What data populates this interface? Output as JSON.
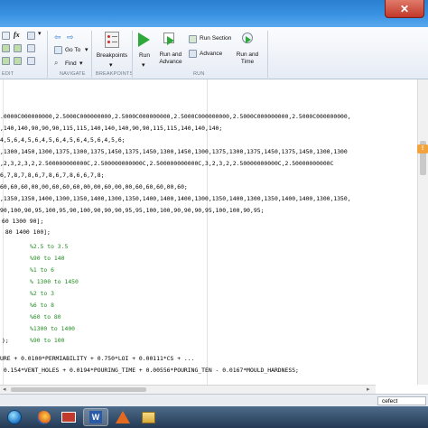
{
  "ribbon": {
    "sections": [
      "EDIT",
      "NAVIGATE",
      "BREAKPOINTS",
      "RUN"
    ],
    "fx_label": "fx",
    "go_to": "Go To",
    "find": "Find",
    "breakpoints": "Breakpoints",
    "run": "Run",
    "run_and_advance": [
      "Run and",
      "Advance"
    ],
    "run_section": "Run Section",
    "advance": "Advance",
    "run_and_time": [
      "Run and",
      "Time"
    ]
  },
  "editor": {
    "lines": [
      ".0000C000000000,2.5000C000000000,2.5000C000000000,2.5000C000000000,2.5000C000000000,2.5000C000000000,",
      ",140,140,90,90,90,115,115,140,140,140,90,90,115,115,140,140,140;",
      "4,5,6,4,5,6,4,5,6,4,5,6,4,5,6,4,5,6;",
      ",1300,1450,1300,1375,1300,1375,1450,1375,1450,1300,1450,1300,1375,1300,1375,1450,1375,1450,1300,1300",
      ",2,3,2,3,2,2.500000000000C,2.500000000000C,2.500000000000C,3,2,3,2,2.50000000000C,2.50000000000C",
      "6,7,8,7,8,6,7,8,6,7,8,6,6,7,8;",
      "60,60,60,00,00,60,60,60,00,00,60,00,00,60,60,60,00,60;",
      ",1350,1350,1400,1300,1350,1400,1300,1350,1400,1400,1400,1300,1350,1400,1300,1350,1400,1400,1300,1350,",
      "90,100,90,95,100,95,90,100,90,90,90,95,95,100,100,90,90,90,95,100,100,90,95;"
    ],
    "assign_lines": [
      "60 1300 90];",
      " 80 1400 100];"
    ],
    "comment_lines": [
      "%2.5 to 3.5",
      "%90 to 140",
      "%1 to 6",
      "% 1300 to 1450",
      "%2 to 3",
      "%6 to 8",
      "%60 to 80",
      "%1300 to 1400",
      "%90 to 100"
    ],
    "comment_prefixes": [
      "",
      "",
      "",
      "",
      "",
      "",
      "",
      "",
      ");"
    ],
    "formula_lines": [
      "URE + 0.0100*PERMIABILITY + 0.750*LOI + 0.00111*CS + ...",
      " 0.154*VENT_HOLES + 0.0194*POURING_TIME + 0.00556*POURING_TEN - 0.0167*MOULD_HARDNESS;"
    ]
  },
  "status_field": "cefect",
  "colors": {
    "comment": "#228b22",
    "titlebar": "#2b7fd1",
    "close": "#c2382a"
  }
}
